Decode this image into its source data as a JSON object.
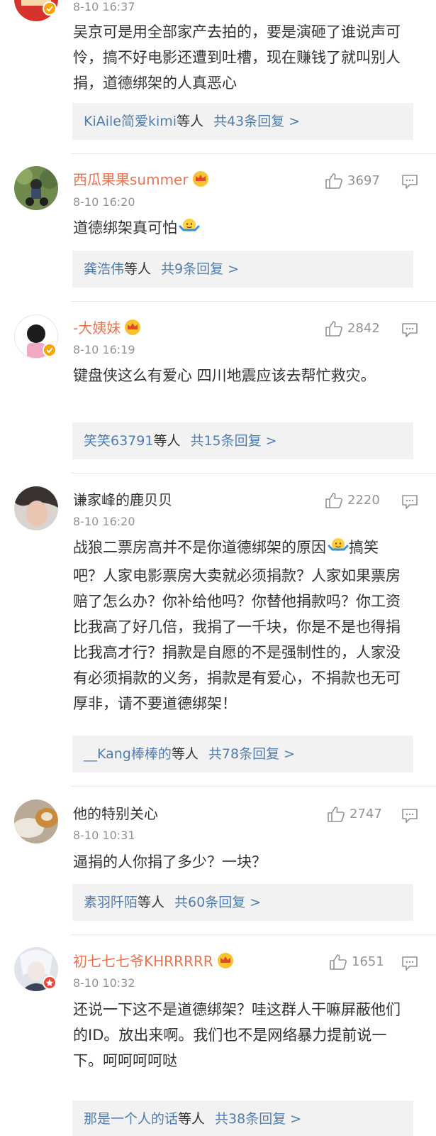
{
  "comments": [
    {
      "time": "8-10 16:37",
      "text": "吴京可是用全部家产去拍的，要是演砸了谁说声可怜，搞不好电影还遭到吐槽，现在赚钱了就叫别人捐，道德绑架的人真恶心",
      "replies": {
        "who": "KiAile简爱kimi",
        "deng": "等人",
        "count": "共43条回复 >"
      }
    },
    {
      "name": "西瓜果果summer",
      "time": "8-10 16:20",
      "likes": "3697",
      "text": "道德绑架真可怕",
      "replies": {
        "who": "龚浩伟",
        "deng": "等人",
        "count": "共9条回复 >"
      }
    },
    {
      "name": "-大姨妹",
      "time": "8-10 16:19",
      "likes": "2842",
      "text": "键盘侠这么有爱心 四川地震应该去帮忙救灾。",
      "replies": {
        "who": "笑笑63791",
        "deng": "等人",
        "count": "共15条回复 >"
      }
    },
    {
      "name": "谦家峰的鹿贝贝",
      "time": "8-10 16:20",
      "likes": "2220",
      "text": "战狼二票房高并不是你道德绑架的原因",
      "text2": "搞笑吧？人家电影票房大卖就必须捐款？人家如果票房赔了怎么办？你补给他吗？你替他捐款吗？你工资比我高了好几倍，我捐了一千块，你是不是也得捐比我高才行？捐款是自愿的不是强制性的，人家没有必须捐款的义务，捐款是有爱心，不捐款也无可厚非，请不要道德绑架！",
      "replies": {
        "who": "__Kang棒棒的",
        "deng": "等人",
        "count": "共78条回复 >"
      }
    },
    {
      "name": "他的特别关心",
      "time": "8-10 10:31",
      "likes": "2747",
      "text": "逼捐的人你捐了多少？一块？",
      "replies": {
        "who": "素羽阡陌",
        "deng": "等人",
        "count": "共60条回复 >"
      }
    },
    {
      "name": "初七七七爷KHRRRRR",
      "time": "8-10 10:32",
      "likes": "1651",
      "text": "还说一下这不是道德绑架？哇这群人干嘛屏蔽他们的ID。放出来啊。我们也不是网络暴力提前说一下。呵呵呵呵哒",
      "replies": {
        "who": "那是一个人的话",
        "deng": "等人",
        "count": "共38条回复 >"
      }
    }
  ],
  "colors": {
    "vip_name": "#eb7350",
    "link": "#507daf",
    "meta": "#939393",
    "reply_bg": "#f2f2f2",
    "divider": "#e6e6e6"
  },
  "icons": [
    "thumbs-up-icon",
    "reply-icon",
    "crown-icon",
    "verified-badge-icon",
    "shrug-emoji-icon"
  ]
}
